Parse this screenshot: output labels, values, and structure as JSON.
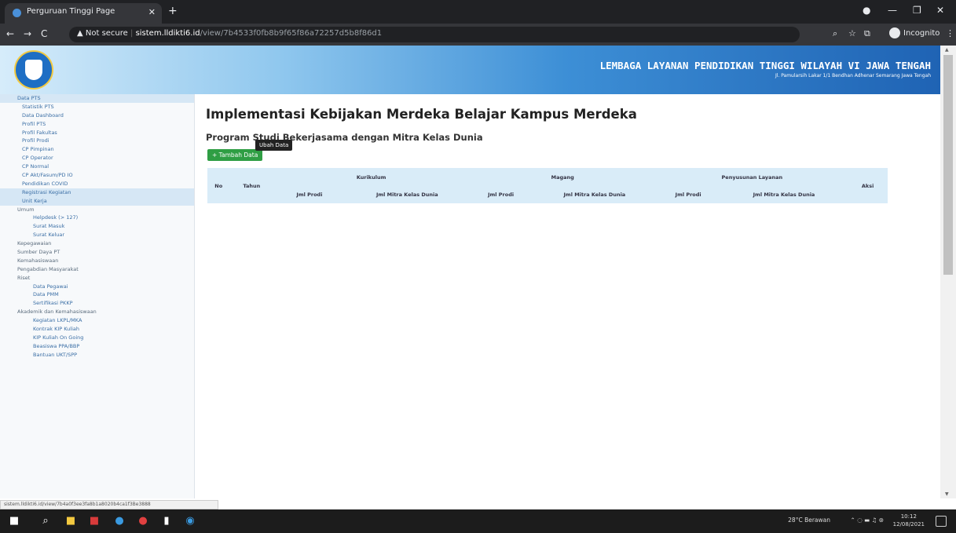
{
  "browser": {
    "tab_title": "Perguruan Tinggi Page",
    "url_warning": "▲ Not secure",
    "url_host": "sistem.lldikti6.id",
    "url_path": "/view/7b4533f0fb8b9f65f86a72257d5b8f86d1",
    "incognito_label": "Incognito"
  },
  "banner": {
    "title": "LEMBAGA LAYANAN PENDIDIKAN TINGGI WILAYAH VI JAWA TENGAH",
    "subtitle": "Jl. Pamularsih Lakar 1/1 Bendhan Adhenar Semarang Jawa Tengah"
  },
  "sidebar": {
    "items": [
      {
        "label": "Data PTS",
        "level": 0,
        "active": true,
        "section": false
      },
      {
        "label": "Statistik PTS",
        "level": 1
      },
      {
        "label": "Data Dashboard",
        "level": 1
      },
      {
        "label": "Profil PTS",
        "level": 1
      },
      {
        "label": "Profil Fakultas",
        "level": 1
      },
      {
        "label": "Profil Prodi",
        "level": 1
      },
      {
        "label": "CP Pimpinan",
        "level": 1
      },
      {
        "label": "CP Operator",
        "level": 1
      },
      {
        "label": "CP Normal",
        "level": 1
      },
      {
        "label": "CP Akt/Fasum/PD IO",
        "level": 1
      },
      {
        "label": "Pendidikan COVID",
        "level": 1
      },
      {
        "label": "Registrasi Kegiatan",
        "level": 1,
        "active": true
      },
      {
        "label": "Unit Kerja",
        "level": 1,
        "active": true
      },
      {
        "label": "Umum",
        "level": 0,
        "section": true
      },
      {
        "label": "Helpdesk (> 127)",
        "level": 2
      },
      {
        "label": "Surat Masuk",
        "level": 2
      },
      {
        "label": "Surat Keluar",
        "level": 2
      },
      {
        "label": "Kepegawaian",
        "level": 0,
        "section": true
      },
      {
        "label": "Sumber Daya PT",
        "level": 0,
        "section": true
      },
      {
        "label": "Kemahasiswaan",
        "level": 0,
        "section": true
      },
      {
        "label": "Pengabdian Masyarakat",
        "level": 0,
        "section": true
      },
      {
        "label": "Riset",
        "level": 0,
        "section": true
      },
      {
        "label": "Data Pegawai",
        "level": 2
      },
      {
        "label": "Data PMM",
        "level": 2
      },
      {
        "label": "Sertifikasi PKKP",
        "level": 2
      },
      {
        "label": "Akademik dan Kemahasiswaan",
        "level": 0,
        "section": true
      },
      {
        "label": "Kegiatan LKPL/MKA",
        "level": 2
      },
      {
        "label": "Kontrak KIP Kuliah",
        "level": 2
      },
      {
        "label": "KIP Kuliah On Going",
        "level": 2
      },
      {
        "label": "Beasiswa PPA/BBP",
        "level": 2
      },
      {
        "label": "Bantuan UKT/SPP",
        "level": 2
      }
    ]
  },
  "status_url": "sistem.lldikti6.id/view/7b4a0f3ee3fa8b1a8020b4ca1f3Be3888",
  "main": {
    "title": "Implementasi Kebijakan Merdeka Belajar Kampus Merdeka",
    "subtitle": "Program Studi Bekerjasama dengan Mitra Kelas Dunia",
    "add_button": "+ Tambah Data",
    "tooltip": "Ubah Data"
  },
  "table": {
    "header_top": {
      "no": "No",
      "tahun": "Tahun",
      "kurikulum": "Kurikulum",
      "magang": "Magang",
      "penyusunan": "Penyusunan Layanan",
      "aksi": "Aksi"
    },
    "header_sub": [
      "Jml Prodi",
      "Jml Mitra Kelas Dunia",
      "Jml Prodi",
      "Jml Mitra Kelas Dunia",
      "Jml Prodi",
      "Jml Mitra Kelas Dunia"
    ]
  },
  "taskbar": {
    "weather": "28°C Berawan",
    "time": "10:12",
    "date": "12/08/2021"
  }
}
